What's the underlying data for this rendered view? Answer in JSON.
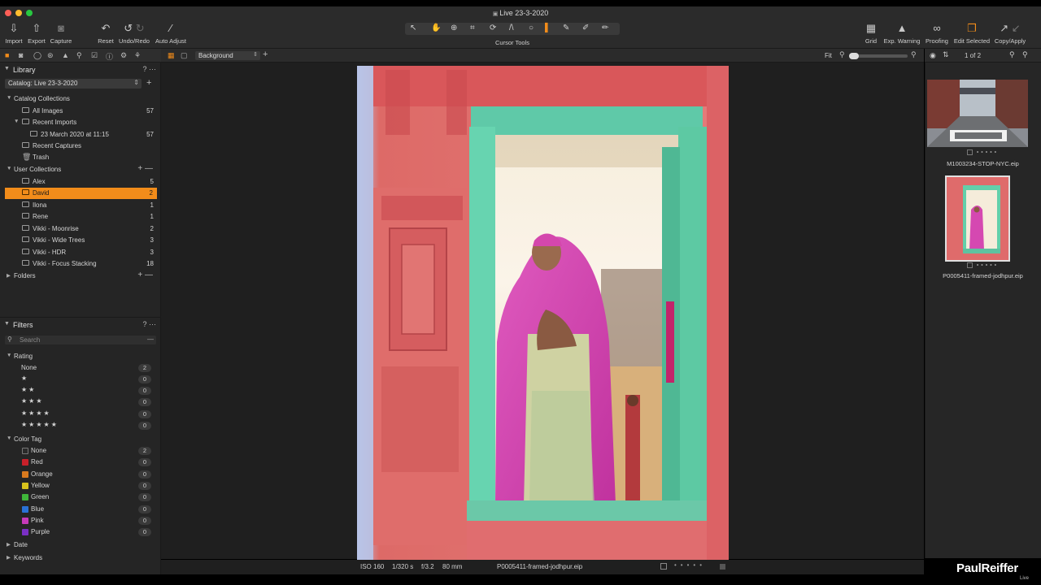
{
  "window": {
    "title": "Live 23-3-2020"
  },
  "toolbar": {
    "left": [
      {
        "label": "Import",
        "icon": "import-icon"
      },
      {
        "label": "Export",
        "icon": "export-icon"
      },
      {
        "label": "Capture",
        "icon": "camera-icon"
      }
    ],
    "edit": [
      {
        "label": "Reset",
        "icon": "reset-icon"
      },
      {
        "label": "Undo/Redo",
        "icon": "undo-icon"
      },
      {
        "label": "Auto Adjust",
        "icon": "wand-icon"
      }
    ],
    "cursor_tools_label": "Cursor Tools",
    "right": [
      {
        "label": "Grid",
        "icon": "grid-icon"
      },
      {
        "label": "Exp. Warning",
        "icon": "warning-icon"
      },
      {
        "label": "Proofing",
        "icon": "glasses-icon"
      },
      {
        "label": "Edit Selected",
        "icon": "stack-icon"
      },
      {
        "label": "Copy/Apply",
        "icon": "copy-apply-icon"
      }
    ]
  },
  "library": {
    "title": "Library",
    "help": "?",
    "catalog": "Catalog: Live 23-3-2020",
    "catalog_collections": {
      "title": "Catalog Collections",
      "items": [
        {
          "label": "All Images",
          "count": "57"
        },
        {
          "label": "Recent Imports",
          "count": ""
        },
        {
          "label": "23 March 2020 at 11:15",
          "count": "57"
        },
        {
          "label": "Recent Captures",
          "count": ""
        },
        {
          "label": "Trash",
          "count": ""
        }
      ]
    },
    "user_collections": {
      "title": "User Collections",
      "items": [
        {
          "label": "Alex",
          "count": "5"
        },
        {
          "label": "David",
          "count": "2"
        },
        {
          "label": "Ilona",
          "count": "1"
        },
        {
          "label": "Rene",
          "count": "1"
        },
        {
          "label": "Vikki - Moonrise",
          "count": "2"
        },
        {
          "label": "Vikki - Wide Trees",
          "count": "3"
        },
        {
          "label": "Vikki - HDR",
          "count": "3"
        },
        {
          "label": "Vikki - Focus Stacking",
          "count": "18"
        }
      ]
    },
    "folders": "Folders"
  },
  "filters": {
    "title": "Filters",
    "help": "?",
    "search_placeholder": "Search",
    "rating": {
      "title": "Rating",
      "items": [
        {
          "label": "None",
          "count": "2"
        },
        {
          "label": "★",
          "count": "0"
        },
        {
          "label": "★★",
          "count": "0"
        },
        {
          "label": "★★★",
          "count": "0"
        },
        {
          "label": "★★★★",
          "count": "0"
        },
        {
          "label": "★★★★★",
          "count": "0"
        }
      ]
    },
    "color_tag": {
      "title": "Color Tag",
      "items": [
        {
          "label": "None",
          "count": "2",
          "color": "#2a2a2a"
        },
        {
          "label": "Red",
          "count": "0",
          "color": "#c8202a"
        },
        {
          "label": "Orange",
          "count": "0",
          "color": "#d97a1e"
        },
        {
          "label": "Yellow",
          "count": "0",
          "color": "#d8c21c"
        },
        {
          "label": "Green",
          "count": "0",
          "color": "#3fb53a"
        },
        {
          "label": "Blue",
          "count": "0",
          "color": "#2a72d6"
        },
        {
          "label": "Pink",
          "count": "0",
          "color": "#c63ab9"
        },
        {
          "label": "Purple",
          "count": "0",
          "color": "#7a2fc4"
        }
      ]
    },
    "date": "Date",
    "keywords": "Keywords"
  },
  "viewer": {
    "layer": "Background",
    "zoom": "Fit",
    "page": "1 of 2"
  },
  "status": {
    "iso": "ISO 160",
    "shutter": "1/320 s",
    "aperture": "f/3.2",
    "focal": "80 mm",
    "filename": "P0005411-framed-jodhpur.eip"
  },
  "browser": {
    "thumbs": [
      {
        "caption": "M1003234-STOP-NYC.eip",
        "selected": false
      },
      {
        "caption": "P0005411-framed-jodhpur.eip",
        "selected": true
      }
    ]
  },
  "colors": {
    "accent": "#f28c1a",
    "panel": "#252525",
    "toolbar": "#2b2b2b"
  },
  "watermark": {
    "name": "PaulReiffer",
    "sub": "Live"
  }
}
